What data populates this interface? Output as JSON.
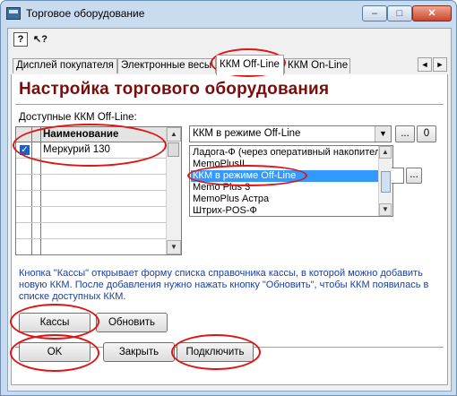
{
  "window": {
    "title": "Торговое оборудование",
    "controls": {
      "minimize": "–",
      "maximize": "□",
      "close": "✕"
    }
  },
  "toolbar": {
    "help_icon": "?",
    "whatsthis_icon": "↖?"
  },
  "tabs": [
    {
      "label": "Дисплей покупателя",
      "active": false
    },
    {
      "label": "Электронные весы",
      "active": false
    },
    {
      "label": "ККМ Off-Line",
      "active": true
    },
    {
      "label": "ККМ On-Line",
      "active": false
    }
  ],
  "tab_nav": {
    "prev": "◄",
    "next": "►"
  },
  "panel": {
    "heading": "Настройка торгового оборудования",
    "list_label": "Доступные ККМ Off-Line:",
    "grid": {
      "column": "Наименование",
      "rows": [
        {
          "name": "Меркурий 130",
          "checked": true
        }
      ]
    },
    "combo_value": "ККМ в режиме Off-Line",
    "combo_btn1": "...",
    "combo_btn2": "0",
    "dropdown": {
      "items": [
        "Ладога-Ф (через оперативный накопитель)",
        "MemoPlusII",
        "ККМ в режиме Off-Line",
        "Memo Plus 3",
        "MemoPlus Астра",
        "Штрих-POS-Ф"
      ],
      "selected_index": 2
    },
    "second_btn": "...",
    "info_text": "Кнопка \"Кассы\" открывает форму списка справочника кассы, в которой можно добавить новую ККМ. После добавления нужно нажать кнопку \"Обновить\", чтобы ККМ появилась в списке доступных ККМ.",
    "buttons": {
      "cash": "Кассы",
      "refresh": "Обновить"
    }
  },
  "footer": {
    "ok": "OK",
    "close": "Закрыть",
    "connect": "Подключить"
  },
  "colors": {
    "heading": "#7a0c0c",
    "info_text": "#1a3fa3",
    "selection": "#3399ff",
    "annotation": "#e01414"
  }
}
